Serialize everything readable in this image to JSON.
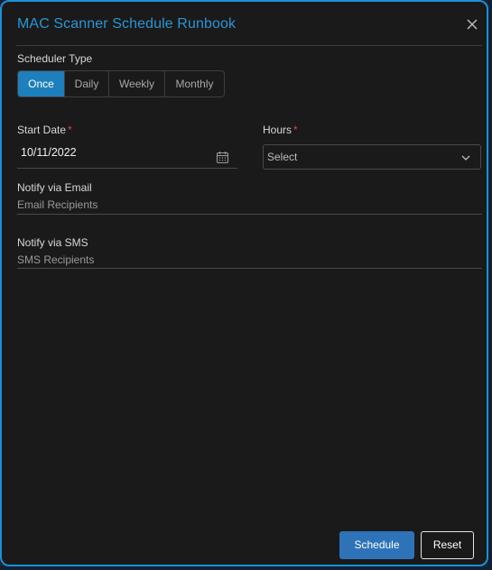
{
  "dialog": {
    "title": "MAC Scanner Schedule Runbook"
  },
  "scheduler_type": {
    "label": "Scheduler Type",
    "options": [
      "Once",
      "Daily",
      "Weekly",
      "Monthly"
    ],
    "selected": "Once"
  },
  "start_date": {
    "label": "Start Date",
    "required_marker": "*",
    "value": "10/11/2022"
  },
  "hours": {
    "label": "Hours",
    "required_marker": "*",
    "placeholder": "Select"
  },
  "email": {
    "label": "Notify via Email",
    "placeholder": "Email Recipients"
  },
  "sms": {
    "label": "Notify via SMS",
    "placeholder": "SMS Recipients"
  },
  "actions": {
    "schedule_label": "Schedule",
    "reset_label": "Reset"
  },
  "colors": {
    "accent": "#1e8fd6",
    "active_segment": "#1e7fbd",
    "primary_button": "#2e72b8",
    "required": "#e0443c",
    "background": "#1a1a1a"
  },
  "icons": {
    "close": "close-icon",
    "calendar": "calendar-icon",
    "dropdown": "chevron-down-icon"
  }
}
